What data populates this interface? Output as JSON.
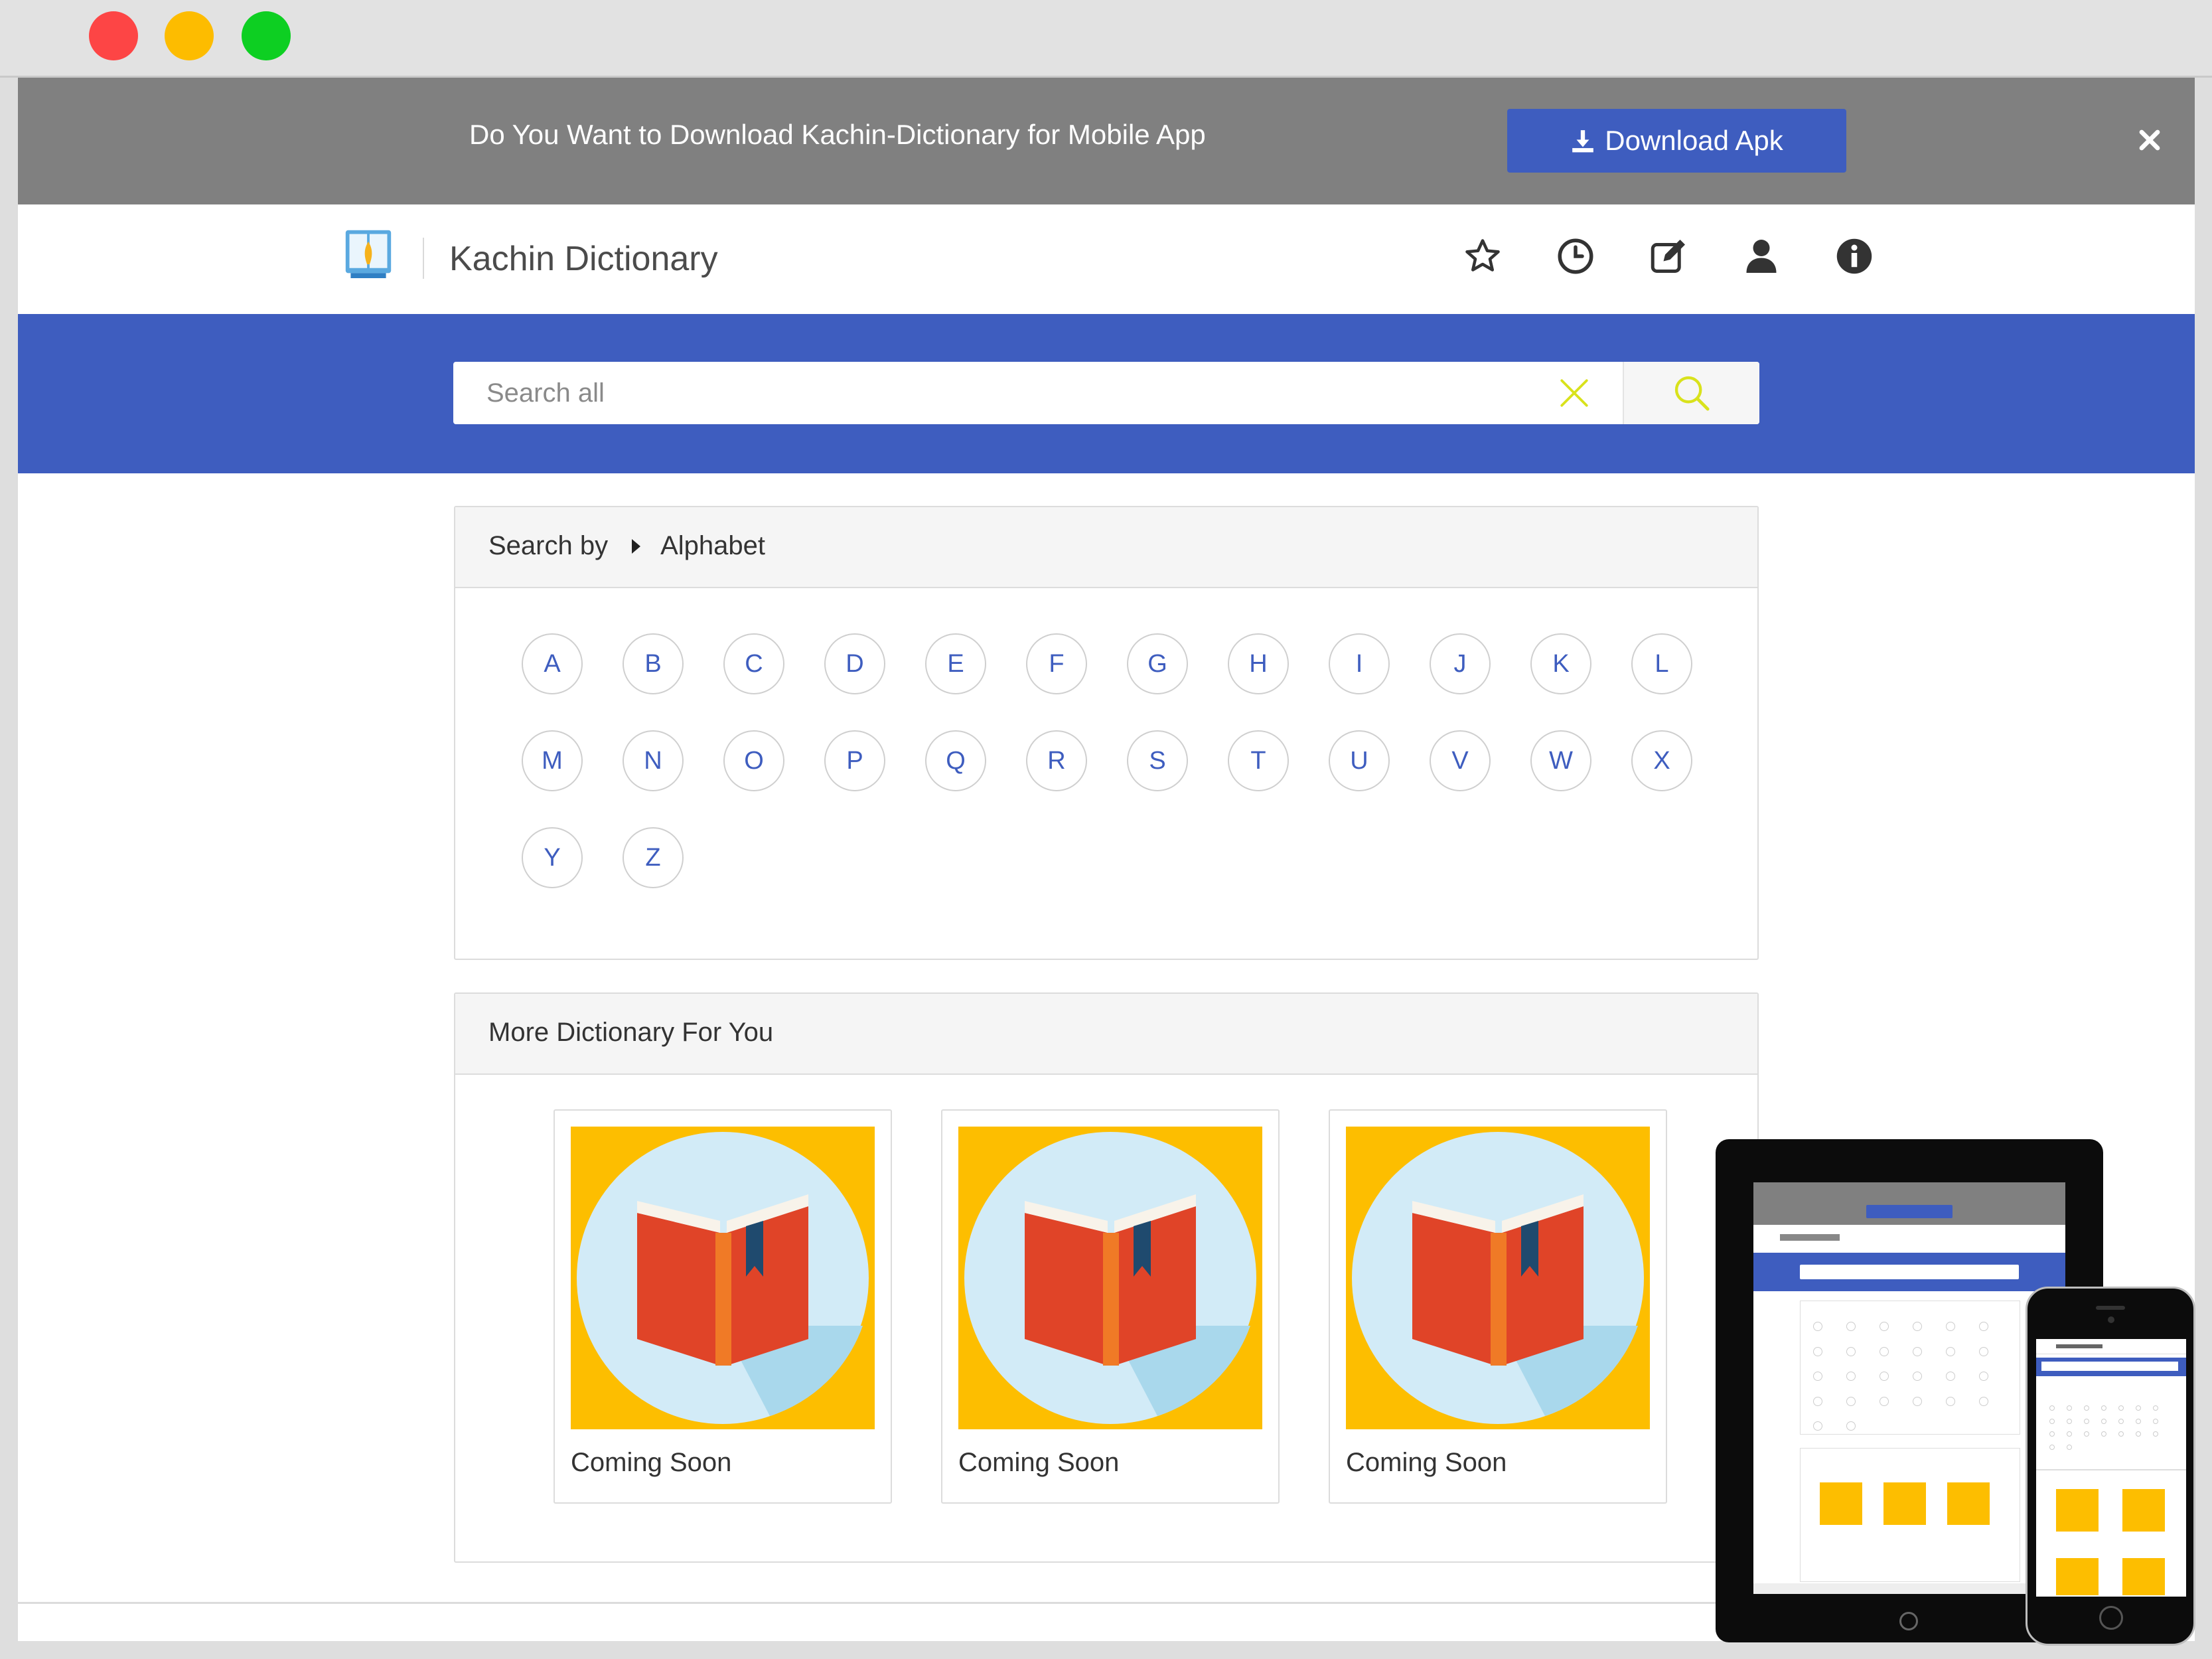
{
  "banner": {
    "message": "Do You Want to Download Kachin-Dictionary for Mobile App",
    "download_label": "Download Apk"
  },
  "header": {
    "brand": "Kachin Dictionary",
    "icons": [
      "star-icon",
      "clock-icon",
      "edit-icon",
      "user-icon",
      "info-icon"
    ]
  },
  "search": {
    "placeholder": "Search all",
    "value": ""
  },
  "alphabet_panel": {
    "search_by_label": "Search by",
    "current_label": "Alphabet",
    "letters": [
      "A",
      "B",
      "C",
      "D",
      "E",
      "F",
      "G",
      "H",
      "I",
      "J",
      "K",
      "L",
      "M",
      "N",
      "O",
      "P",
      "Q",
      "R",
      "S",
      "T",
      "U",
      "V",
      "W",
      "X",
      "Y",
      "Z"
    ]
  },
  "more_panel": {
    "title": "More Dictionary For You",
    "cards": [
      {
        "label": "Coming Soon"
      },
      {
        "label": "Coming Soon"
      },
      {
        "label": "Coming Soon"
      }
    ]
  },
  "colors": {
    "accent": "#3e5dbf",
    "banner_bg": "#808080",
    "search_icon": "#d9e21c",
    "card_bg": "#fdbe00",
    "book_red": "#e04428"
  }
}
